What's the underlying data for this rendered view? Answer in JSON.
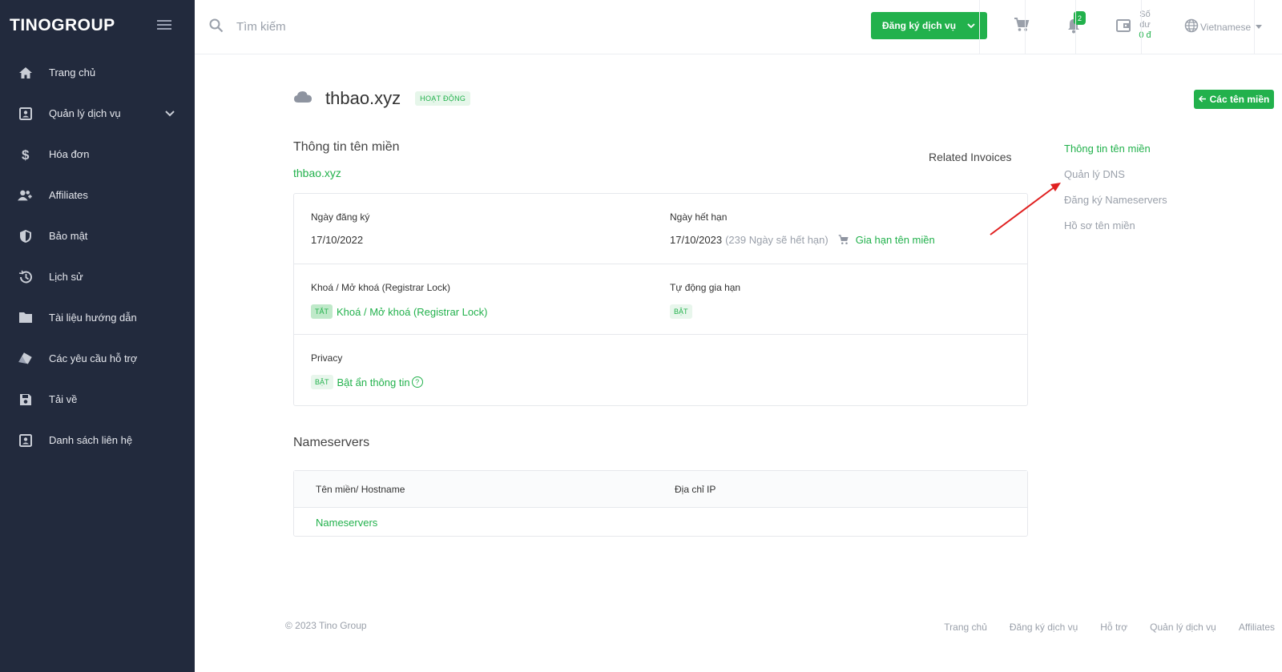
{
  "sidebar": {
    "logo": "TINOGROUP",
    "items": [
      {
        "label": "Trang chủ",
        "icon": "home-icon"
      },
      {
        "label": "Quản lý dịch vụ",
        "icon": "service-icon"
      },
      {
        "label": "Hóa đơn",
        "icon": "dollar-icon"
      },
      {
        "label": "Affiliates",
        "icon": "users-icon"
      },
      {
        "label": "Bảo mật",
        "icon": "shield-icon"
      },
      {
        "label": "Lịch sử",
        "icon": "history-icon"
      },
      {
        "label": "Tài liệu hướng dẫn",
        "icon": "folder-icon"
      },
      {
        "label": "Các yêu cầu hỗ trợ",
        "icon": "ticket-icon"
      },
      {
        "label": "Tải về",
        "icon": "download-icon"
      },
      {
        "label": "Danh sách liên hệ",
        "icon": "contact-icon"
      }
    ]
  },
  "topbar": {
    "search_placeholder": "Tìm kiếm",
    "register_label": "Đăng ký dịch vụ",
    "notification_count": "2",
    "balance_label_1": "Số",
    "balance_label_2": "dư",
    "balance_amount": "0 đ",
    "language": "Vietnamese"
  },
  "page": {
    "title": "thbao.xyz",
    "status": "HOẠT ĐỘNG",
    "back_button": "Các tên miền"
  },
  "domain_info": {
    "section_title": "Thông tin tên miền",
    "domain_link": "thbao.xyz",
    "related_invoices": "Related Invoices",
    "register_date_label": "Ngày đăng ký",
    "register_date": "17/10/2022",
    "expiry_date_label": "Ngày hết hạn",
    "expiry_date": "17/10/2023",
    "expiry_remaining": "(239 Ngày sẽ hết hạn)",
    "renew_link": "Gia hạn tên miền",
    "lock_label": "Khoá / Mở khoá (Registrar Lock)",
    "lock_state": "TẮT",
    "lock_link": "Khoá / Mở khoá (Registrar Lock)",
    "auto_renew_label": "Tự động gia hạn",
    "auto_renew_state": "BẬT",
    "privacy_label": "Privacy",
    "privacy_state": "BẬT",
    "privacy_link": "Bật ẩn thông tin",
    "help_mark": "?"
  },
  "side_menu": [
    {
      "label": "Thông tin tên miền",
      "active": true
    },
    {
      "label": "Quản lý DNS",
      "active": false
    },
    {
      "label": "Đăng ký Nameservers",
      "active": false
    },
    {
      "label": "Hồ sơ tên miền",
      "active": false
    }
  ],
  "nameservers": {
    "section_title": "Nameservers",
    "col_hostname": "Tên miền/ Hostname",
    "col_ip": "Địa chỉ IP",
    "row_link": "Nameservers"
  },
  "footer": {
    "copyright": "© 2023 Tino Group",
    "links": [
      "Trang chủ",
      "Đăng ký dịch vụ",
      "Hỗ trợ",
      "Quản lý dịch vụ",
      "Affiliates"
    ]
  },
  "colors": {
    "sidebar_bg": "#222a3d",
    "accent": "#22b14c",
    "annotation_arrow": "#e02020"
  }
}
